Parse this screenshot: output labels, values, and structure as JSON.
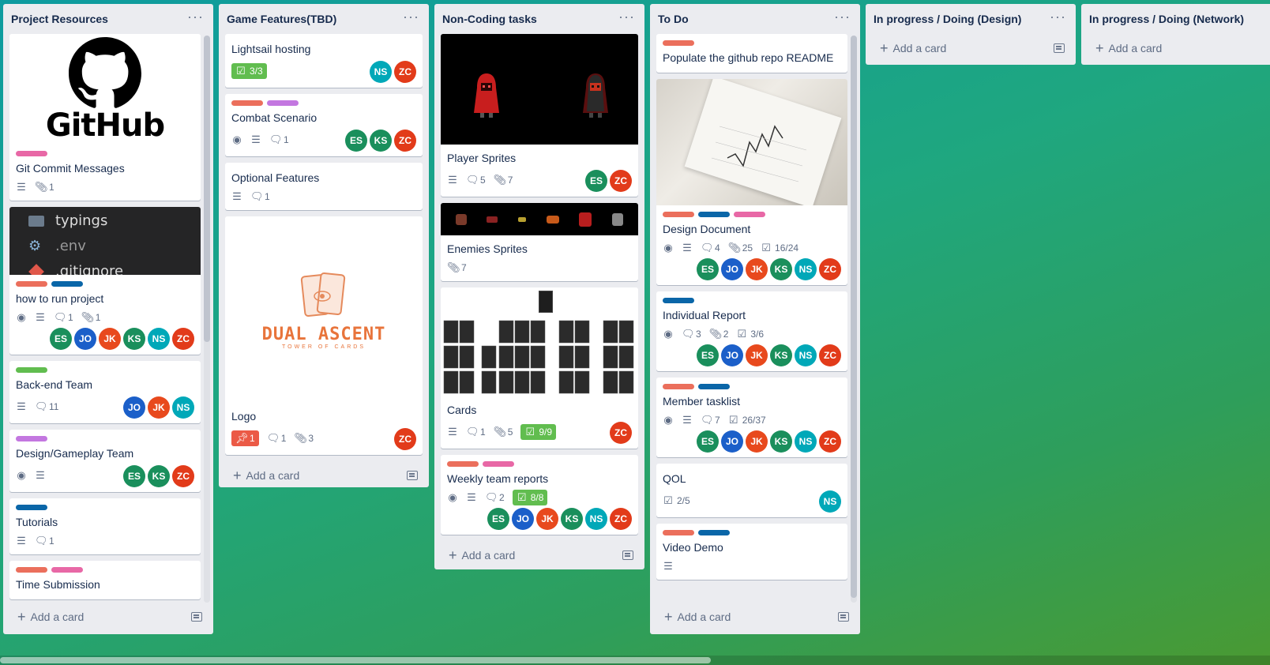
{
  "colors": {
    "red": "#eb5a46",
    "pink": "#ff78cb",
    "purple": "#c377e0",
    "blue": "#0079bf",
    "green": "#61bd4f",
    "orange": "#ff9f1a"
  },
  "avatars": {
    "ES": "#1a8f5c",
    "JO": "#1b5fc9",
    "JK": "#e8491d",
    "KS": "#1a8f5c",
    "NS": "#00a8b8",
    "ZC": "#e23b1a"
  },
  "add_card_label": "Add a card",
  "list_menu_label": "···",
  "lists": [
    {
      "title": "Project Resources"
    },
    {
      "title": "Game Features(TBD)"
    },
    {
      "title": "Non-Coding tasks"
    },
    {
      "title": "To Do"
    },
    {
      "title": "In progress / Doing (Design)"
    },
    {
      "title": "In progress / Doing (Network)"
    }
  ],
  "cards": {
    "p1": {
      "cover_text": "GitHub",
      "title": "Git Commit Messages",
      "attachments": "1"
    },
    "p2": {
      "cover_lines": [
        "typings",
        ".env",
        ".gitignore"
      ],
      "title": "how to run project",
      "comments": "1",
      "attachments": "1"
    },
    "p3": {
      "title": "Back-end Team",
      "comments": "11"
    },
    "p4": {
      "title": "Design/Gameplay Team"
    },
    "p5": {
      "title": "Tutorials",
      "comments": "1"
    },
    "p6": {
      "title": "Time Submission"
    },
    "g1": {
      "title": "Lightsail hosting",
      "checklist": "3/3"
    },
    "g2": {
      "title": "Combat Scenario",
      "comments": "1"
    },
    "g3": {
      "title": "Optional Features",
      "comments": "1"
    },
    "g4": {
      "logo_title": "DUAL ASCENT",
      "logo_sub": "TOWER OF CARDS",
      "title": "Logo",
      "due": "1",
      "comments": "1",
      "attachments": "3"
    },
    "n1": {
      "title": "Player Sprites",
      "comments": "5",
      "attachments": "7"
    },
    "n2": {
      "title": "Enemies Sprites",
      "attachments": "7"
    },
    "n3": {
      "title": "Cards",
      "comments": "1",
      "attachments": "5",
      "checklist": "9/9"
    },
    "n4": {
      "title": "Weekly team reports",
      "comments": "2",
      "checklist": "8/8"
    },
    "t1": {
      "title": "Populate the github repo README"
    },
    "t2": {
      "title": "Design Document",
      "comments": "4",
      "attachments": "25",
      "checklist": "16/24"
    },
    "t3": {
      "title": "Individual Report",
      "comments": "3",
      "attachments": "2",
      "checklist": "3/6"
    },
    "t4": {
      "title": "Member tasklist",
      "comments": "7",
      "checklist": "26/37"
    },
    "t5": {
      "title": "QOL",
      "checklist": "2/5"
    },
    "t6": {
      "title": "Video Demo"
    }
  }
}
